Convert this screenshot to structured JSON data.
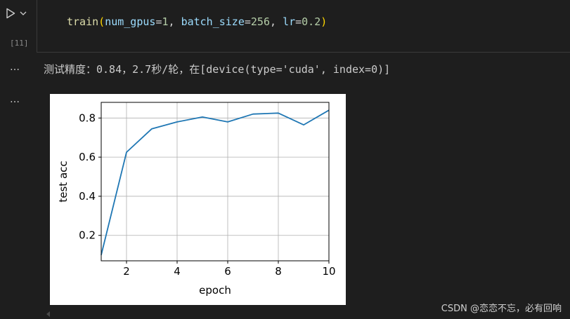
{
  "cell": {
    "execution_count": "[11]",
    "run_icon": "play-icon",
    "dropdown_icon": "chevron-down-icon",
    "code": {
      "fn": "train",
      "open": "(",
      "p1": "num_gpus",
      "eq1": "=",
      "v1": "1",
      "c1": ", ",
      "p2": "batch_size",
      "eq2": "=",
      "v2": "256",
      "c2": ", ",
      "p3": "lr",
      "eq3": "=",
      "v3": "0.2",
      "close": ")"
    }
  },
  "outputs": {
    "gutter_label": "…",
    "text": "测试精度：0.84，2.7秒/轮，在[device(type='cuda', index=0)]"
  },
  "chart_data": {
    "type": "line",
    "title": "",
    "xlabel": "epoch",
    "ylabel": "test acc",
    "xlim": [
      1,
      10
    ],
    "ylim": [
      0.07,
      0.88
    ],
    "xticks": [
      2,
      4,
      6,
      8,
      10
    ],
    "yticks": [
      0.2,
      0.4,
      0.6,
      0.8
    ],
    "xtick_labels": [
      "2",
      "4",
      "6",
      "8",
      "10"
    ],
    "ytick_labels": [
      "0.2",
      "0.4",
      "0.6",
      "0.8"
    ],
    "grid": true,
    "series": [
      {
        "color": "#1f77b4",
        "x": [
          1,
          2,
          3,
          4,
          5,
          6,
          7,
          8,
          9,
          10
        ],
        "y": [
          0.1,
          0.625,
          0.745,
          0.78,
          0.805,
          0.78,
          0.82,
          0.825,
          0.765,
          0.84
        ]
      }
    ]
  },
  "watermark": "CSDN @恋恋不忘，必有回响"
}
